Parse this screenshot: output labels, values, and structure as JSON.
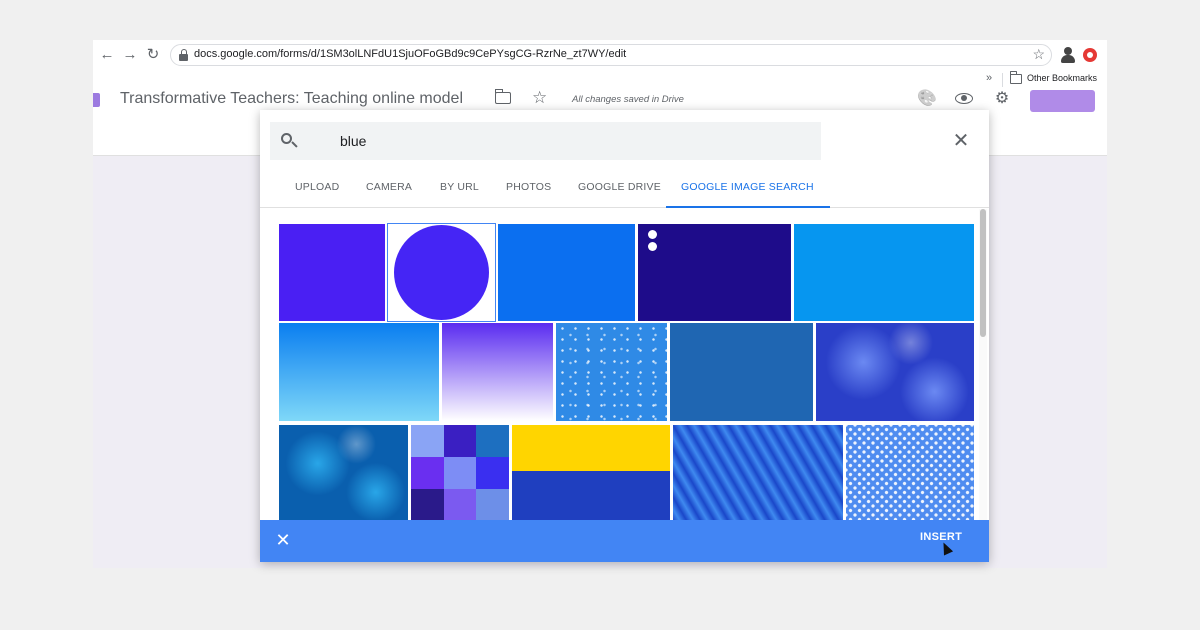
{
  "browser": {
    "url": "docs.google.com/forms/d/1SM3olLNFdU1SjuOFoGBd9c9CePYsgCG-RzrNe_zt7WY/edit",
    "back_glyph": "←",
    "forward_glyph": "→",
    "reload_glyph": "↻",
    "star_glyph": "☆",
    "more_glyph": "»",
    "other_bookmarks": "Other Bookmarks"
  },
  "forms_header": {
    "title": "Transformative Teachers: Teaching online model",
    "star_glyph": "☆",
    "saved_status": "All changes saved in Drive",
    "palette_glyph": "🎨",
    "gear_glyph": "⚙"
  },
  "dialog": {
    "search_value": "blue",
    "close_glyph": "✕",
    "tabs": [
      {
        "label": "UPLOAD",
        "active": false
      },
      {
        "label": "CAMERA",
        "active": false
      },
      {
        "label": "BY URL",
        "active": false
      },
      {
        "label": "PHOTOS",
        "active": false
      },
      {
        "label": "GOOGLE DRIVE",
        "active": false
      },
      {
        "label": "GOOGLE IMAGE SEARCH",
        "active": true
      }
    ],
    "results": [
      {
        "name": "image-result-violet-square",
        "fill": "#4a1ff3",
        "kind": "solid"
      },
      {
        "name": "image-result-blue-circle",
        "fill": "#4525f5",
        "kind": "circle",
        "selected": true
      },
      {
        "name": "image-result-azure",
        "fill": "#0b6ff0",
        "kind": "solid"
      },
      {
        "name": "image-result-navy-dots",
        "fill": "#1e0c8a",
        "kind": "dots"
      },
      {
        "name": "image-result-sky-blue",
        "fill": "#0696f0",
        "kind": "solid"
      },
      {
        "name": "image-result-sky-gradient",
        "fill": "#0a7ef0",
        "fill2": "#7fd8f8",
        "kind": "vgradient"
      },
      {
        "name": "image-result-purple-gradient",
        "fill": "#5a2cf0",
        "fill2": "#ffffff",
        "kind": "vgradient"
      },
      {
        "name": "image-result-dotted-blue",
        "fill": "#2f8ae6",
        "kind": "speckle"
      },
      {
        "name": "image-result-denim",
        "fill": "#1f66b2",
        "kind": "solid"
      },
      {
        "name": "image-result-bokeh",
        "fill": "#2a3fc8",
        "fill2": "#6b89f2",
        "kind": "bokeh"
      },
      {
        "name": "image-result-underwater",
        "fill": "#0a5fae",
        "fill2": "#29a6e8",
        "kind": "bokeh"
      },
      {
        "name": "image-result-color-checker",
        "kind": "checker"
      },
      {
        "name": "image-result-yellow-blue-flag",
        "fill": "#ffd500",
        "fill2": "#1f3fbf",
        "kind": "split"
      },
      {
        "name": "image-result-blue-feathers",
        "fill": "#1a47c9",
        "fill2": "#3f8af0",
        "kind": "streaks"
      },
      {
        "name": "image-result-polka-dots",
        "fill": "#4f8cf0",
        "kind": "polka"
      }
    ],
    "insert_label": "INSERT"
  },
  "colors": {
    "accent": "#4285f4",
    "tab_active": "#1a73e8",
    "forms_purple": "#b08be8"
  }
}
